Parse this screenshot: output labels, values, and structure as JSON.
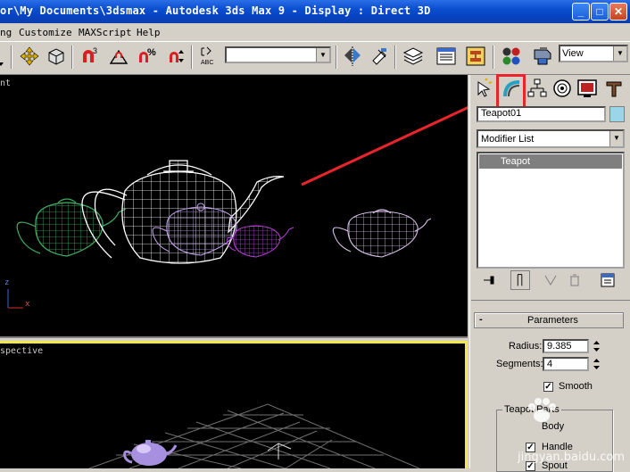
{
  "window": {
    "title": "or\\My Documents\\3dsmax    - Autodesk 3ds Max 9    - Display : Direct 3D",
    "controls": [
      "_",
      "□",
      "✕"
    ]
  },
  "menu": [
    "ng",
    "Customize",
    "MAXScript",
    "Help"
  ],
  "toolbar": {
    "selection_set_value": "",
    "view_combo_value": "View"
  },
  "viewports": {
    "front_label": "nt",
    "perspective_label": "spective",
    "axis": {
      "z": "z",
      "x": "x"
    }
  },
  "command_panel": {
    "object_name": "Teapot01",
    "object_color": "#9ad6e8",
    "modifier_list_label": "Modifier List",
    "stack_item": "Teapot",
    "parameters": {
      "rollout_sign": "-",
      "title": "Parameters",
      "radius_label": "Radius:",
      "radius_value": "9.385",
      "segments_label": "Segments:",
      "segments_value": "4",
      "smooth_label": "Smooth",
      "smooth_checked": "✓",
      "teapot_parts_label": "Teapot Parts",
      "body_label": "Body",
      "handle_label": "Handle",
      "spout_label": "Spout",
      "handle_checked": "✓",
      "spout_checked": "✓"
    }
  },
  "highlight_color": "#e8242c",
  "watermark": "jingyan.baidu.com"
}
